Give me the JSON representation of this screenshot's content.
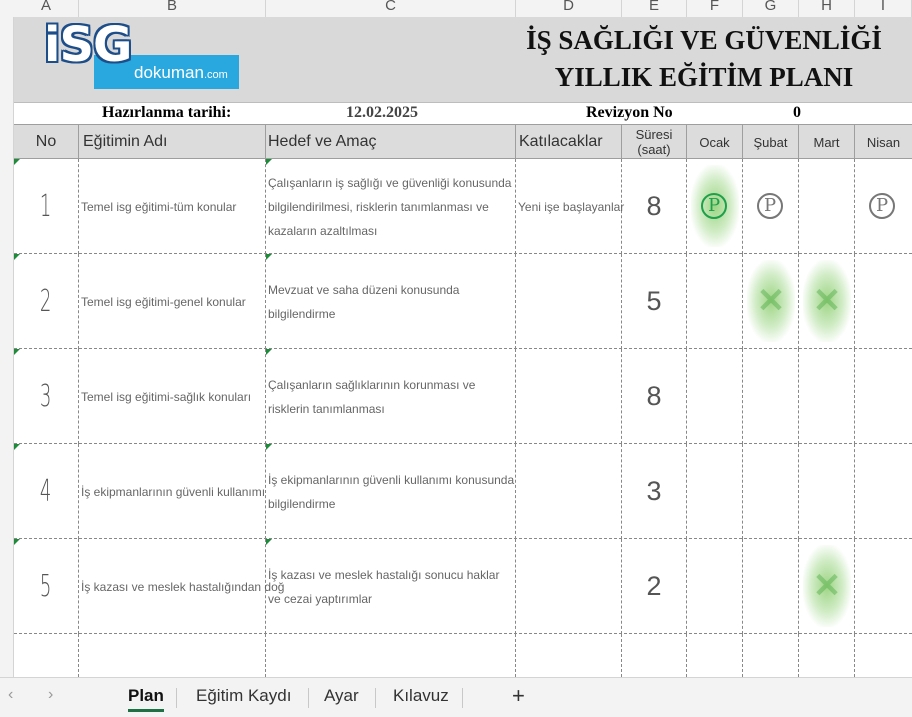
{
  "columns": [
    "A",
    "B",
    "C",
    "D",
    "E",
    "F",
    "G",
    "H",
    "I"
  ],
  "banner": {
    "logo_main": "iSG",
    "logo_sub": "dokuman",
    "logo_tld": ".com",
    "title_line1": "İŞ SAĞLIĞI VE GÜVENLİĞİ",
    "title_line2": "YILLIK EĞİTİM PLANI"
  },
  "info": {
    "date_label": "Hazırlanma tarihi:",
    "date_value": "12.02.2025",
    "rev_label": "Revizyon No",
    "rev_value": "0"
  },
  "headers": {
    "no": "No",
    "name": "Eğitimin Adı",
    "goal": "Hedef ve Amaç",
    "participants": "Katılacaklar",
    "duration": "Süresi (saat)",
    "m1": "Ocak",
    "m2": "Şubat",
    "m3": "Mart",
    "m4": "Nisan"
  },
  "rows": [
    {
      "no": "1",
      "name": "Temel isg eğitimi-tüm konular",
      "goal": "Çalışanların iş sağlığı ve güvenliği konusunda bilgilendirilmesi, risklerin tanımlanması ve kazaların azaltılması",
      "participants": "Yeni işe başlayanlar",
      "duration": "8",
      "marks": [
        "P*",
        "P",
        "",
        "P"
      ]
    },
    {
      "no": "2",
      "name": "Temel isg eğitimi-genel konular",
      "goal": "Mevzuat ve saha düzeni konusunda bilgilendirme",
      "participants": "",
      "duration": "5",
      "marks": [
        "",
        "X",
        "X",
        ""
      ]
    },
    {
      "no": "3",
      "name": "Temel isg eğitimi-sağlık konuları",
      "goal": "Çalışanların sağlıklarının korunması ve risklerin tanımlanması",
      "participants": "",
      "duration": "8",
      "marks": [
        "",
        "",
        "",
        ""
      ]
    },
    {
      "no": "4",
      "name": "İş ekipmanlarının güvenli kullanımı",
      "goal": "İş ekipmanlarının güvenli kullanımı konusunda bilgilendirme",
      "participants": "",
      "duration": "3",
      "marks": [
        "",
        "",
        "",
        ""
      ]
    },
    {
      "no": "5",
      "name": "İş kazası ve meslek hastalığından doğ",
      "goal": "İş kazası ve meslek hastalığı sonucu haklar ve cezai yaptırımlar",
      "participants": "",
      "duration": "2",
      "marks": [
        "",
        "",
        "X",
        ""
      ]
    }
  ],
  "plan_symbol": "Ⓟ",
  "done_symbol": "✕",
  "tabs": [
    "Plan",
    "Eğitim Kaydı",
    "Ayar",
    "Kılavuz"
  ],
  "add_sheet": "+",
  "nav_prev": "‹",
  "nav_next": "›"
}
